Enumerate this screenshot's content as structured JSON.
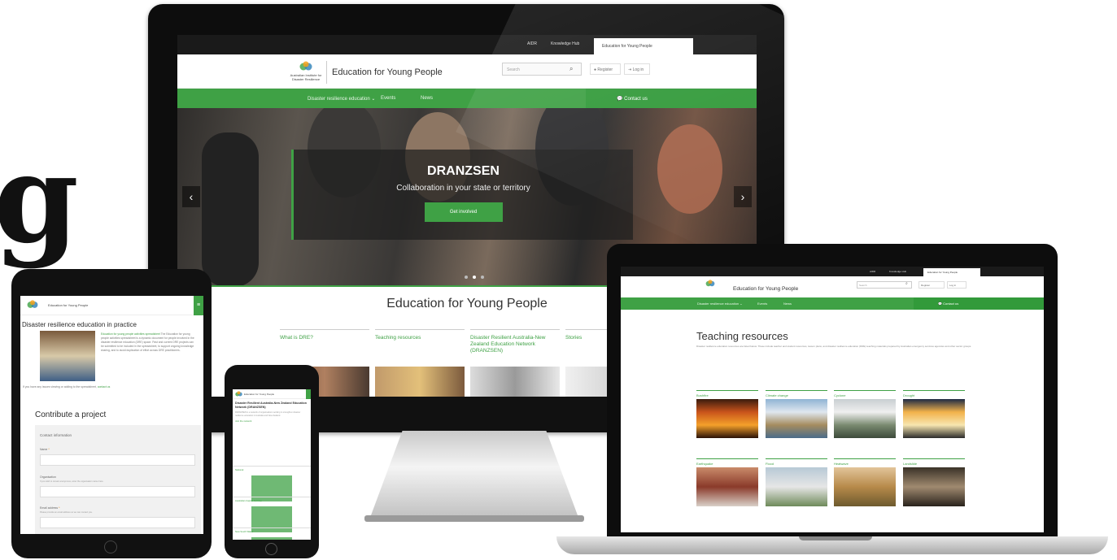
{
  "background_text": "g",
  "colors": {
    "brand_green": "#3fa145",
    "dark_bar": "#1a1a1a",
    "text": "#333333"
  },
  "monitor": {
    "topbar": {
      "links": [
        "AIDR",
        "Knowledge Hub"
      ],
      "active_tab": "Education for Young People"
    },
    "header": {
      "org_name": "Australian Institute for Disaster Resilience",
      "site_title": "Education for Young People",
      "search_placeholder": "Search",
      "register_label": "Register",
      "login_label": "Log in"
    },
    "nav": {
      "items": [
        "Disaster resilience education ⌄",
        "Events",
        "News"
      ],
      "contact_label": "Contact us"
    },
    "hero": {
      "heading": "DRANZSEN",
      "subheading": "Collaboration in your state or territory",
      "button_label": "Get involved",
      "prev_icon": "chevron-left-icon",
      "next_icon": "chevron-right-icon"
    },
    "main_title": "Education for Young People",
    "cards": [
      "What is DRE?",
      "Teaching resources",
      "Disaster Resilient Australia-New Zealand Education Network (DRANZSEN)",
      "Stories"
    ]
  },
  "laptop": {
    "topbar": {
      "links": [
        "AIDR",
        "Knowledge Hub"
      ],
      "active_tab": "Education for Young People"
    },
    "header": {
      "site_title": "Education for Young People",
      "search_placeholder": "Search",
      "register_label": "Register",
      "login_label": "Log in"
    },
    "nav": {
      "items": [
        "Disaster resilience education ⌄",
        "Events",
        "News"
      ],
      "contact_label": "Contact us"
    },
    "heading": "Teaching resources",
    "intro": "Disaster resilience education resources are listed below. These include teacher and student resources, lesson plans, and disaster resilience education (DRE) teaching materials prepared by Australian emergency services agencies and other sector groups.",
    "tiles": [
      "Bushfire",
      "Climate change",
      "Cyclone",
      "Drought",
      "Earthquake",
      "Flood",
      "Heatwave",
      "Landslide"
    ]
  },
  "tablet": {
    "header_title": "Education for Young People",
    "heading": "Disaster resilience education in practice",
    "body_link": "Education for young people activities spreadsheet",
    "body": "The Education for young people activities spreadsheet is a dynamic document for people involved in the disaster resilience education (DRE) space. Past and current DRE projects can be submitted to be included in the spreadsheet, to support ongoing knowledge sharing, and to avoid duplication of effort across DRE practitioners.",
    "note": "If you have any issues viewing or adding to the spreadsheet,",
    "note_link": "contact us",
    "form_heading": "Contribute a project",
    "form_section": "Contact information",
    "name_label": "Name",
    "org_label": "Organisation",
    "org_help": "If you wish to remain anonymous, enter the organisation name here.",
    "email_label": "Email address",
    "email_help": "Please provide an email address so we can contact you."
  },
  "phone": {
    "header_title": "Education for Young People",
    "heading": "Disaster Resilient Australia-New Zealand Education Network (DRANZSEN)",
    "body": "DRANZSEN is a network of organisations working to strengthen disaster resilience education in Australia and New Zealand.",
    "link": "Join the network",
    "sections": [
      "National",
      "Australian Capital Territory",
      "New South Wales"
    ]
  }
}
